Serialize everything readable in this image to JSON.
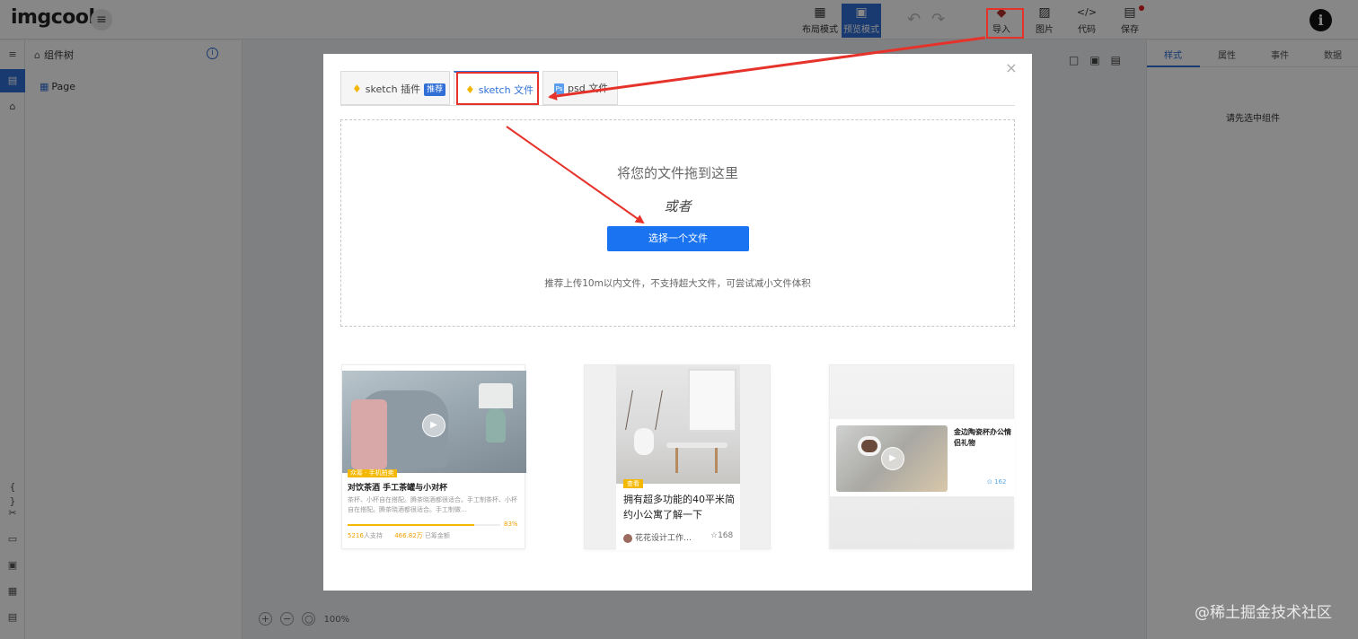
{
  "app": {
    "logo": "imgcook",
    "menu_glyph": "≡",
    "undo_redo": "↶↷"
  },
  "toolbar": {
    "items": [
      {
        "label": "布局模式",
        "icon": "▦"
      },
      {
        "label": "预览模式",
        "icon": "▣"
      },
      {
        "label": "导入",
        "icon": "◆"
      },
      {
        "label": "图片",
        "icon": "▨"
      },
      {
        "label": "代码",
        "icon": "</>"
      },
      {
        "label": "保存",
        "icon": "▤"
      }
    ],
    "info_glyph": "i"
  },
  "left_rail": {
    "icons": [
      "≡",
      "▤",
      "⌂",
      "{ }",
      "✂",
      "▭",
      "▣",
      "▦",
      "▤"
    ]
  },
  "tree_panel": {
    "title": "组件树",
    "title_icon": "⌂",
    "info_glyph": "i",
    "root_node": "Page",
    "root_icon": "▦"
  },
  "right_panel": {
    "tabs": [
      "样式",
      "属性",
      "事件",
      "数据"
    ],
    "empty_text": "请先选中组件"
  },
  "canvas": {
    "tools": "□▣▤",
    "zoom_controls": [
      "+",
      "−",
      "○"
    ],
    "zoom": "100%"
  },
  "modal": {
    "close_glyph": "×",
    "tabs": [
      {
        "label": "sketch 插件",
        "badge": "推荐",
        "icon": "sketch-icon"
      },
      {
        "label": "sketch 文件",
        "icon": "sketch-icon"
      },
      {
        "label": "psd 文件",
        "icon": "psd-icon",
        "icon_text": "Ps"
      }
    ],
    "sketch_glyph": "♦",
    "dropzone": {
      "title": "将您的文件拖到这里",
      "or": "或者",
      "button": "选择一个文件",
      "hint": "推荐上传10m以内文件，不支持超大文件，可尝试减小文件体积"
    },
    "cards": [
      {
        "tag": "众筹 · 手机拍卖",
        "title": "对饮茶酒 手工茶罐与小对杯",
        "desc": "茶杯、小杯自在搭配。腾茶晓酒都很适合。手工制茶杯、小杯自在搭配。腾茶晓酒都很适合。手工制做…",
        "progress": 0.83,
        "progress_label": "83%",
        "stat_people": "5216",
        "stat_people_label": "人支持",
        "stat_amount": "466.82万",
        "stat_amount_label": "已筹金额"
      },
      {
        "tag": "查看",
        "title": "拥有超多功能的40平米简约小公寓了解一下",
        "author": "花花设计工作…",
        "likes": "☆168"
      },
      {
        "title": "金边陶瓷杯办公情侣礼物",
        "stat": "⊙ 162"
      }
    ],
    "play_glyph": "▶"
  },
  "watermark": "@稀土掘金技术社区",
  "colors": {
    "accent": "#2f6fd6",
    "primary_button": "#1a73f0",
    "annotation": "#e5332b",
    "sketch_yellow": "#f2b705"
  }
}
